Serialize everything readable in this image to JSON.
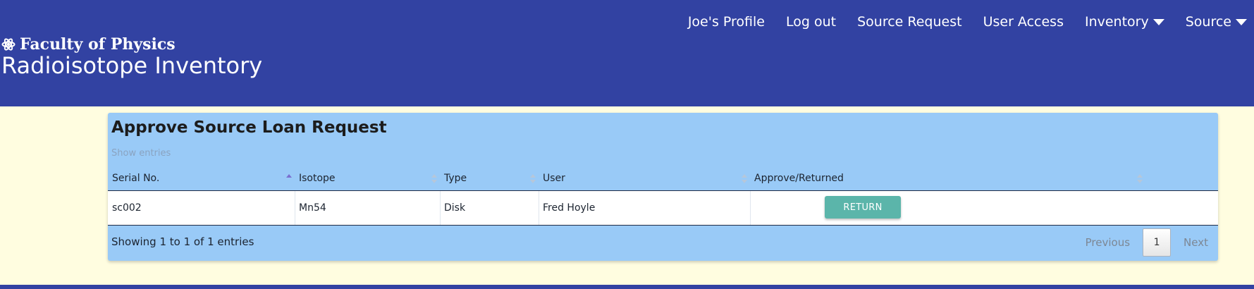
{
  "header": {
    "org": "Faculty of Physics",
    "app_title": "Radioisotope Inventory",
    "logo_icon": "atom-icon",
    "nav": [
      {
        "label": "Joe's Profile",
        "dropdown": false
      },
      {
        "label": "Log out",
        "dropdown": false
      },
      {
        "label": "Source Request",
        "dropdown": false
      },
      {
        "label": "User Access",
        "dropdown": false
      },
      {
        "label": "Inventory",
        "dropdown": true
      },
      {
        "label": "Source",
        "dropdown": true
      }
    ]
  },
  "panel": {
    "title": "Approve Source Loan Request",
    "show_entries": "Show entries",
    "columns": [
      "Serial No.",
      "Isotope",
      "Type",
      "User",
      "Approve/Returned"
    ],
    "sorted_column": "Serial No.",
    "rows": [
      {
        "serial": "sc002",
        "isotope": "Mn54",
        "type": "Disk",
        "user": "Fred Hoyle",
        "action": "RETURN"
      }
    ],
    "info": "Showing 1 to 1 of 1 entries",
    "pager": {
      "previous": "Previous",
      "current": "1",
      "next": "Next"
    }
  },
  "colors": {
    "header_bg": "#3242a2",
    "page_bg": "#fffde0",
    "panel_bg": "#99caf7",
    "button": "#5bb5aa"
  }
}
